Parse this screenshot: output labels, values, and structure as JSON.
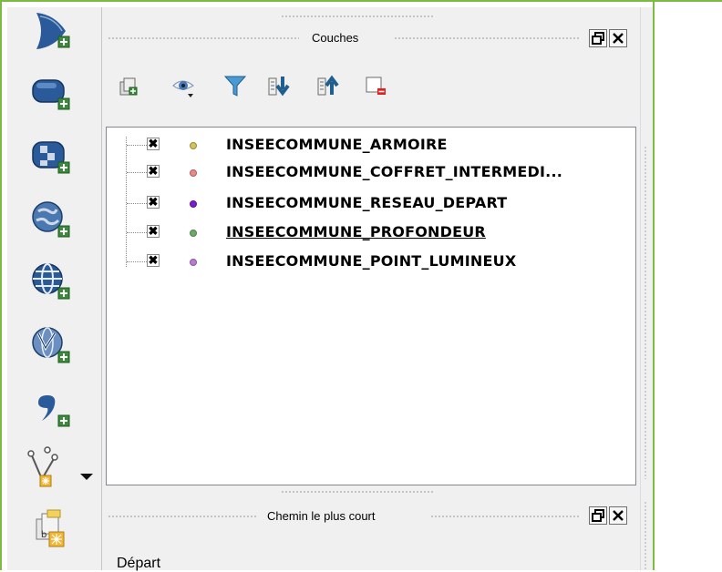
{
  "panels": {
    "layers": {
      "title": "Couches",
      "restore_icon": "restore-window-icon",
      "close_icon": "close-icon"
    },
    "shortest_path": {
      "title": "Chemin le plus court",
      "restore_icon": "restore-window-icon",
      "close_icon": "close-icon",
      "departure_label": "Départ"
    }
  },
  "left_toolbar": {
    "icons": [
      "add-delimited-text-layer-icon",
      "add-vector-layer-icon",
      "add-raster-layer-icon",
      "add-wms-layer-icon",
      "add-wfs-layer-icon",
      "add-wcs-layer-icon",
      "add-spatialite-layer-icon",
      "new-shapefile-layer-icon",
      "add-virtual-layer-icon"
    ]
  },
  "layers_toolbar": {
    "icons": [
      "add-group-icon",
      "manage-visibility-icon",
      "filter-legend-icon",
      "expand-all-icon",
      "collapse-all-icon",
      "remove-layer-icon"
    ]
  },
  "layers": [
    {
      "name": "INSEECOMMUNE_ARMOIRE",
      "checked": "✖",
      "color": "#d4c35c",
      "border": "#9a8a30",
      "underlined": false
    },
    {
      "name": "INSEECOMMUNE_COFFRET_INTERMEDI...",
      "checked": "✖",
      "color": "#e68a8a",
      "border": "#b25c5c",
      "underlined": false
    },
    {
      "name": "INSEECOMMUNE_RESEAU_DEPART",
      "checked": "✖",
      "color": "#7a1fc4",
      "border": "#5a0fa0",
      "underlined": false
    },
    {
      "name": "INSEECOMMUNE_PROFONDEUR",
      "checked": "✖",
      "color": "#6fa86a",
      "border": "#4d7f49",
      "underlined": true
    },
    {
      "name": "INSEECOMMUNE_POINT_LUMINEUX",
      "checked": "✖",
      "color": "#b77cd1",
      "border": "#8a55a3",
      "underlined": false
    }
  ],
  "colors": {
    "frame": "#7cba42",
    "panel_bg": "#f0f0f0"
  }
}
